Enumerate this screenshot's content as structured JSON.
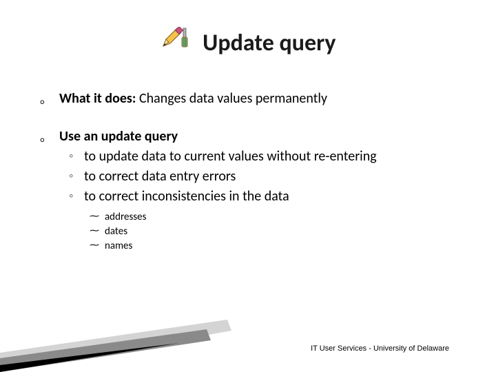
{
  "title": "Update query",
  "icon": "pencil-screwdriver-icon",
  "bullets": [
    {
      "prefix_bold": "What it does:",
      "rest": " Changes data values permanently"
    },
    {
      "prefix_bold": "Use an update query",
      "rest": "",
      "subs": [
        "to update data to current values without re-entering",
        "to correct data entry errors",
        "to correct inconsistencies in the data"
      ],
      "subsubs": [
        "addresses",
        "dates",
        "names"
      ]
    }
  ],
  "footer": "IT User Services - University of Delaware"
}
